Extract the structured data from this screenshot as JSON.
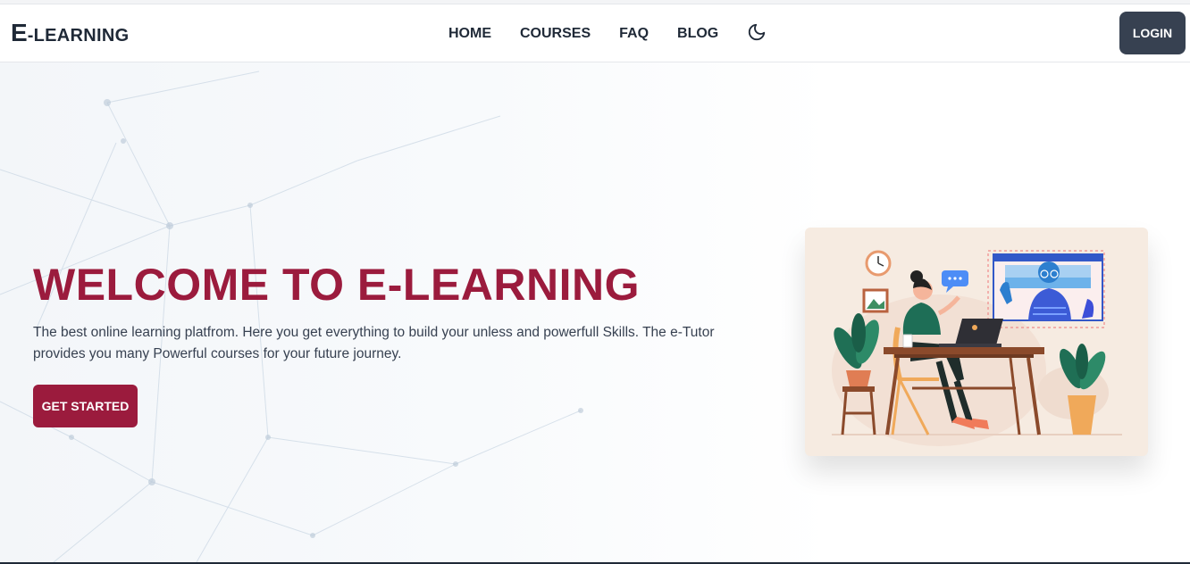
{
  "navbar": {
    "logo_letter": "E",
    "logo_rest": "-LEARNING",
    "links": [
      "HOME",
      "COURSES",
      "FAQ",
      "BLOG"
    ],
    "theme_icon": "moon-icon",
    "login_label": "LOGIN"
  },
  "hero": {
    "title": "WELCOME TO E-LEARNING",
    "description": "The best online learning platfrom. Here you get everything to build your unless and powerfull Skills. The e-Tutor provides you many Powerful courses for your future journey.",
    "cta_label": "GET STARTED",
    "illustration": "online-learning-illustration"
  },
  "colors": {
    "brand": "#9b1b3d",
    "dark": "#1f2937",
    "login_bg": "#374151",
    "illustration_bg": "#f6ebe1"
  }
}
